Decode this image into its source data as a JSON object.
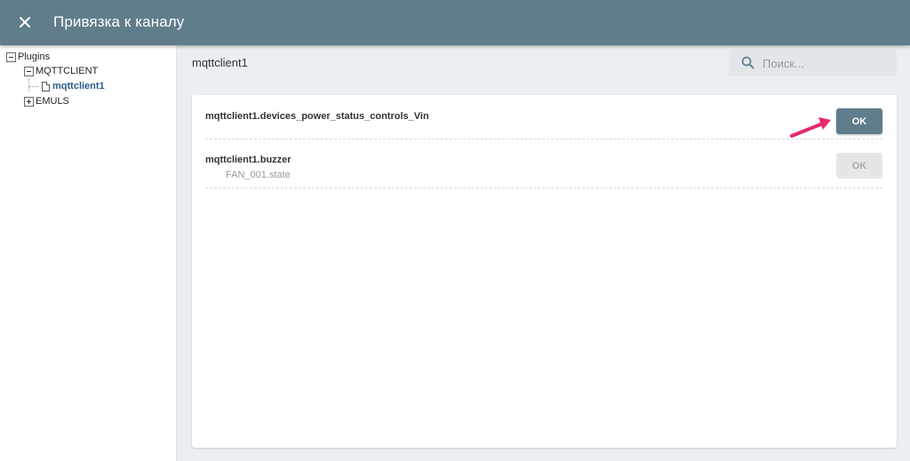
{
  "header": {
    "title": "Привязка к каналу",
    "close_icon": "close-icon"
  },
  "tree": {
    "root": "Plugins",
    "group1": "MQTTCLIENT",
    "selected_item": "mqttclient1",
    "group2": "EMULS"
  },
  "content": {
    "breadcrumb": "mqttclient1",
    "search_placeholder": "Поиск...",
    "search_value": ""
  },
  "channels": [
    {
      "name": "mqttclient1.devices_power_status_controls_Vin",
      "sub": "",
      "ok_label": "OK",
      "enabled": true
    },
    {
      "name": "mqttclient1.buzzer",
      "sub": "FAN_001.state",
      "ok_label": "OK",
      "enabled": false
    }
  ],
  "colors": {
    "header_bg": "#607d8b",
    "ok_active": "#607d8b",
    "ok_disabled": "#e6e6e6",
    "selected_tree": "#2a5d8a",
    "arrow": "#e8296b"
  }
}
